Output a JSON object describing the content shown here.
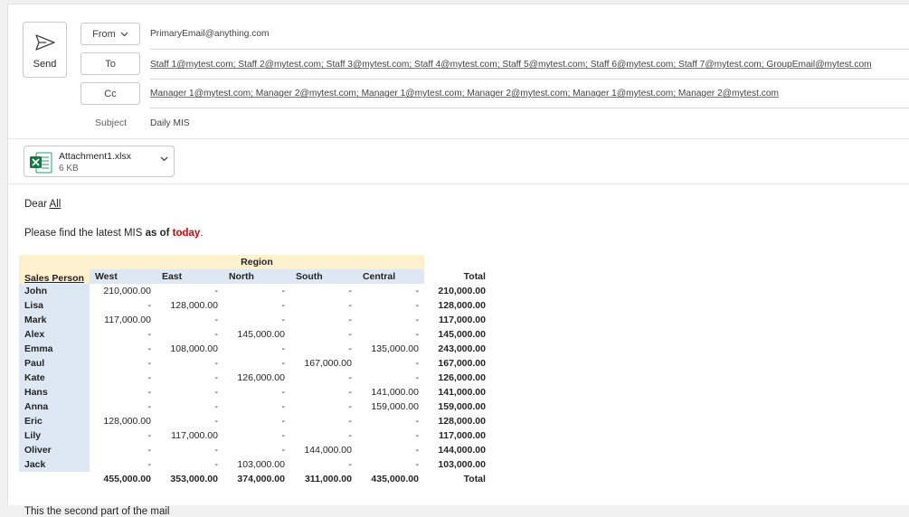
{
  "compose": {
    "send_label": "Send",
    "from_label": "From",
    "from_value": "PrimaryEmail@anything.com",
    "to_label": "To",
    "to_value": "Staff 1@mytest.com; Staff 2@mytest.com; Staff 3@mytest.com; Staff 4@mytest.com; Staff 5@mytest.com; Staff 6@mytest.com; Staff 7@mytest.com; GroupEmail@mytest.com",
    "cc_label": "Cc",
    "cc_value": "Manager 1@mytest.com; Manager 2@mytest.com; Manager 1@mytest.com; Manager 2@mytest.com; Manager 1@mytest.com; Manager 2@mytest.com",
    "subject_label": "Subject",
    "subject_value": "Daily MIS"
  },
  "attachment": {
    "name": "Attachment1.xlsx",
    "size": "6 KB",
    "icon": "excel-file-icon"
  },
  "body": {
    "greeting_prefix": "Dear",
    "greeting_name": "All",
    "line_prefix": "Please find the latest MIS",
    "line_bold": "as of",
    "line_red": "today",
    "line_suffix": ".",
    "trailing_text": "This the second part of the mail"
  },
  "table": {
    "region_header": "Region",
    "sales_person_header": "Sales Person",
    "columns": [
      "West",
      "East",
      "North",
      "South",
      "Central",
      "Total"
    ],
    "rows": [
      {
        "name": "John",
        "values": [
          "210,000.00",
          "-",
          "-",
          "-",
          "-",
          "210,000.00"
        ]
      },
      {
        "name": "Lisa",
        "values": [
          "-",
          "128,000.00",
          "-",
          "-",
          "-",
          "128,000.00"
        ]
      },
      {
        "name": "Mark",
        "values": [
          "117,000.00",
          "-",
          "-",
          "-",
          "-",
          "117,000.00"
        ]
      },
      {
        "name": "Alex",
        "values": [
          "-",
          "-",
          "145,000.00",
          "-",
          "-",
          "145,000.00"
        ]
      },
      {
        "name": "Emma",
        "values": [
          "-",
          "108,000.00",
          "-",
          "-",
          "135,000.00",
          "243,000.00"
        ]
      },
      {
        "name": "Paul",
        "values": [
          "-",
          "-",
          "-",
          "167,000.00",
          "-",
          "167,000.00"
        ]
      },
      {
        "name": "Kate",
        "values": [
          "-",
          "-",
          "126,000.00",
          "-",
          "-",
          "126,000.00"
        ]
      },
      {
        "name": "Hans",
        "values": [
          "-",
          "-",
          "-",
          "-",
          "141,000.00",
          "141,000.00"
        ]
      },
      {
        "name": "Anna",
        "values": [
          "-",
          "-",
          "-",
          "-",
          "159,000.00",
          "159,000.00"
        ]
      },
      {
        "name": "Eric",
        "values": [
          "128,000.00",
          "-",
          "-",
          "-",
          "-",
          "128,000.00"
        ]
      },
      {
        "name": "Lily",
        "values": [
          "-",
          "117,000.00",
          "-",
          "-",
          "-",
          "117,000.00"
        ]
      },
      {
        "name": "Oliver",
        "values": [
          "-",
          "-",
          "-",
          "144,000.00",
          "-",
          "144,000.00"
        ]
      },
      {
        "name": "Jack",
        "values": [
          "-",
          "-",
          "103,000.00",
          "-",
          "-",
          "103,000.00"
        ]
      }
    ],
    "totals": [
      "455,000.00",
      "353,000.00",
      "374,000.00",
      "311,000.00",
      "435,000.00",
      "Total"
    ]
  },
  "colors": {
    "header_yellow": "#fdf0cc",
    "header_blue": "#dde8f4",
    "today_red": "#e00000",
    "excel_green": "#107c41"
  }
}
